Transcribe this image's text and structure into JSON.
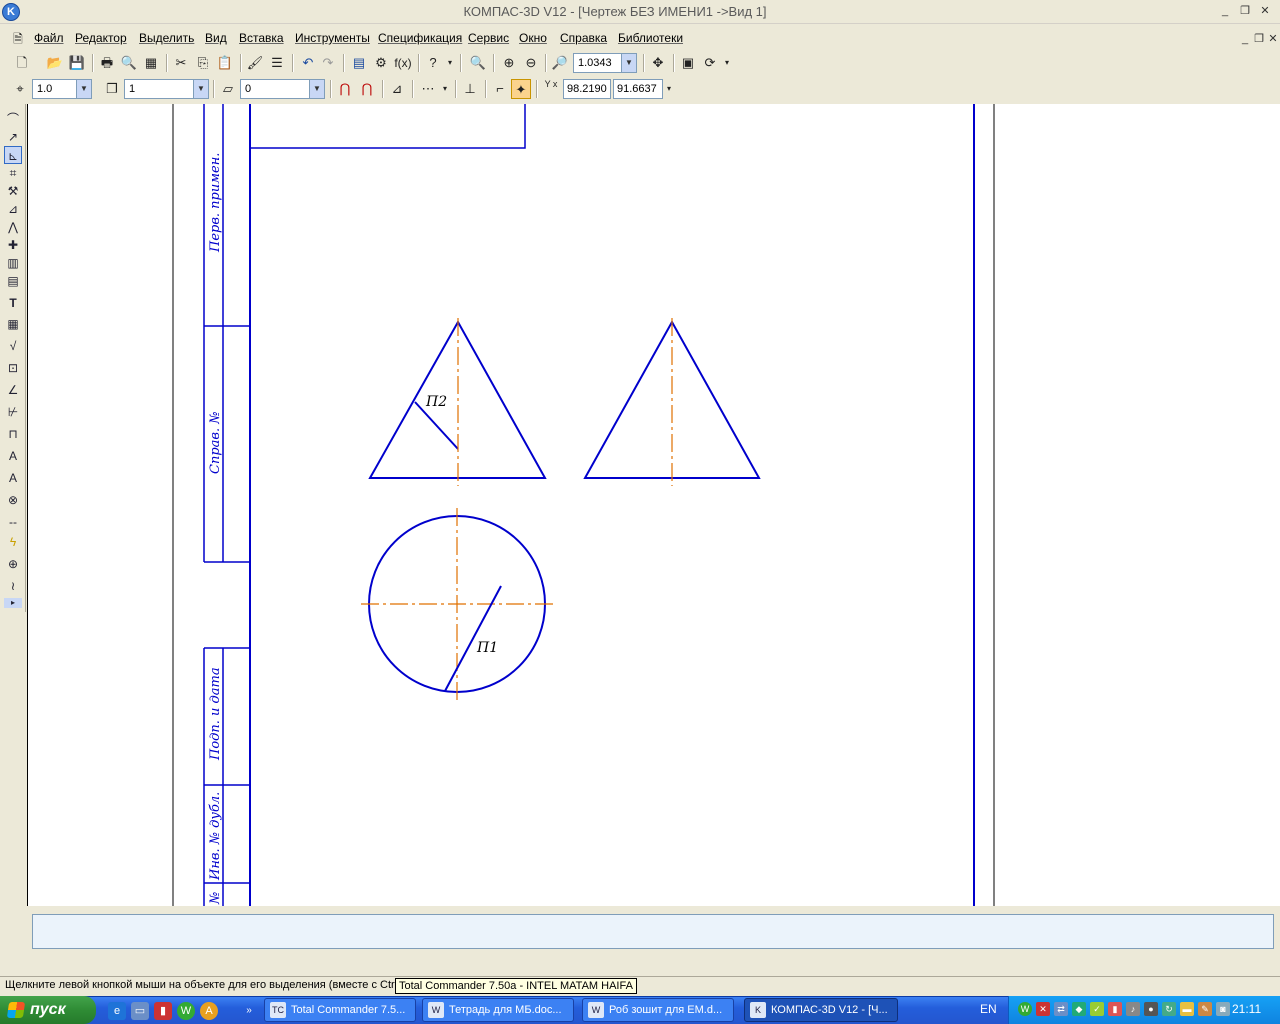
{
  "window": {
    "app_icon_letter": "K",
    "title": "КОМПАС-3D V12 - [Чертеж БЕЗ ИМЕНИ1 ->Вид 1]",
    "controls": [
      "_",
      "❐",
      "✕"
    ],
    "doc_controls": [
      "_",
      "❐",
      "✕"
    ]
  },
  "menu": [
    "Файл",
    "Редактор",
    "Выделить",
    "Вид",
    "Вставка",
    "Инструменты",
    "Спецификация",
    "Сервис",
    "Окно",
    "Справка",
    "Библиотеки"
  ],
  "toolbar_standard": {
    "zoom_value": "1.0343"
  },
  "toolbar_current_state": {
    "step_value": "1.0",
    "layer_value": "1",
    "style_value": "0",
    "coord_x": "98.2190",
    "coord_y": "91.6637",
    "coord_label": "Y x"
  },
  "drawing": {
    "stamp_labels": [
      "Перв. примен.",
      "Справ. №",
      "Подп. и дата",
      "Инв. № дубл.",
      "№"
    ],
    "label_p2": "П2",
    "label_p1": "П1",
    "colors": {
      "outline": "#0000cc",
      "axis": "#e07000"
    }
  },
  "status": {
    "hint": "Щелкните левой кнопкой мыши на объекте для его выделения (вместе с Ctrl или Shift - добавить к выделенным)",
    "tooltip": "Total Commander 7.50a - INTEL MATAM HAIFA"
  },
  "taskbar": {
    "start_label": "пуск",
    "tasks": [
      {
        "label": "Total Commander 7.5...",
        "icon": "TC"
      },
      {
        "label": "Тетрадь для МБ.doc...",
        "icon": "W"
      },
      {
        "label": "Роб зошит для ЕМ.d...",
        "icon": "W"
      },
      {
        "label": "КОМПАС-3D V12 - [Ч...",
        "icon": "K"
      }
    ],
    "lang": "EN",
    "clock": "21:11"
  }
}
